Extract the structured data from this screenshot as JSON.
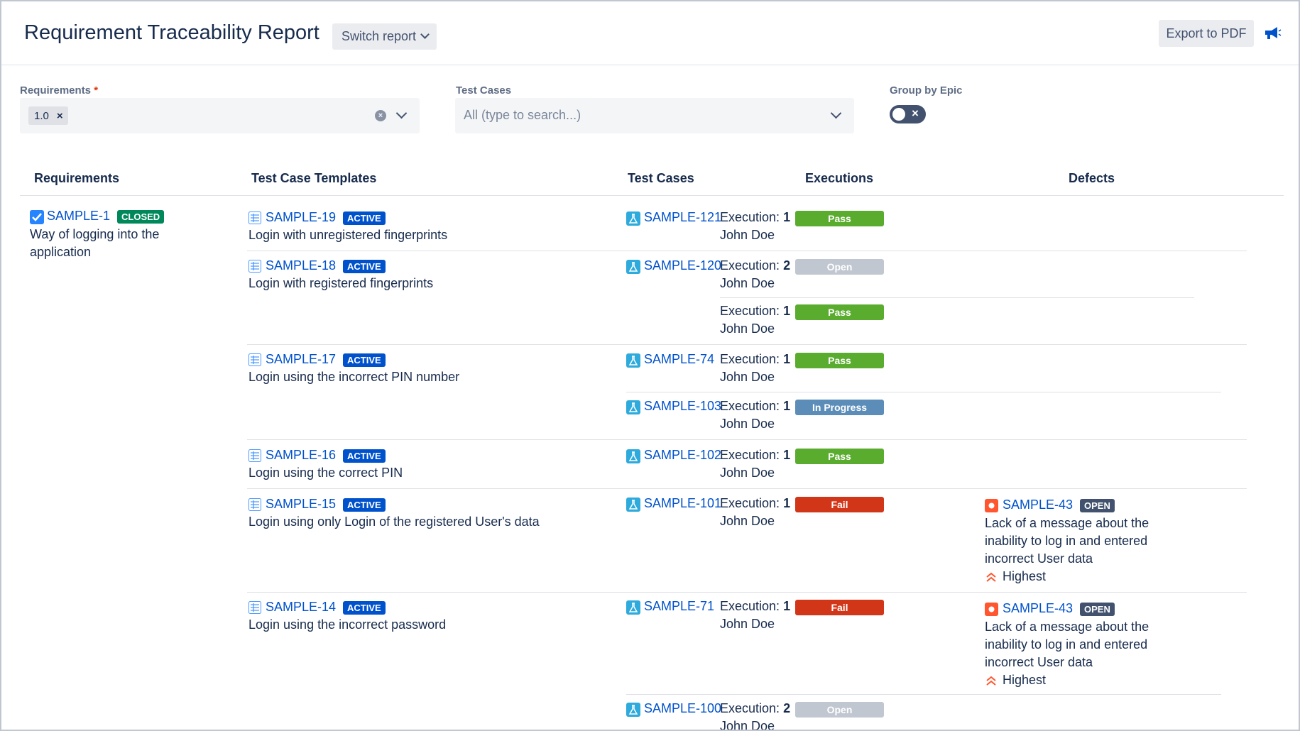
{
  "header": {
    "title": "Requirement Traceability Report",
    "switch_label": "Switch report",
    "export_label": "Export to PDF"
  },
  "filters": {
    "requirements_label": "Requirements",
    "requirements_required_mark": "*",
    "requirements_tag": "1.0",
    "test_cases_label": "Test Cases",
    "test_cases_placeholder": "All (type to search...)",
    "group_by_epic_label": "Group by Epic",
    "group_by_epic_on": false
  },
  "columns": {
    "requirements": "Requirements",
    "templates": "Test Case Templates",
    "test_cases": "Test Cases",
    "executions": "Executions",
    "defects": "Defects"
  },
  "requirement": {
    "key": "SAMPLE-1",
    "status": "CLOSED",
    "summary_line1": "Way of logging into the",
    "summary_line2": "application"
  },
  "execution_label": "Execution:",
  "templates": [
    {
      "key": "SAMPLE-19",
      "status": "ACTIVE",
      "summary": "Login with unregistered fingerprints"
    },
    {
      "key": "SAMPLE-18",
      "status": "ACTIVE",
      "summary": "Login with registered fingerprints"
    },
    {
      "key": "SAMPLE-17",
      "status": "ACTIVE",
      "summary": "Login using the incorrect PIN number"
    },
    {
      "key": "SAMPLE-16",
      "status": "ACTIVE",
      "summary": "Login using the correct PIN"
    },
    {
      "key": "SAMPLE-15",
      "status": "ACTIVE",
      "summary": "Login using only Login of the registered User's data"
    },
    {
      "key": "SAMPLE-14",
      "status": "ACTIVE",
      "summary": "Login using the incorrect password"
    }
  ],
  "test_cases": [
    {
      "key": "SAMPLE-121",
      "executions": [
        {
          "number": "1",
          "user": "John Doe",
          "status": "Pass"
        }
      ]
    },
    {
      "key": "SAMPLE-120",
      "executions": [
        {
          "number": "2",
          "user": "John Doe",
          "status": "Open"
        },
        {
          "number": "1",
          "user": "John Doe",
          "status": "Pass"
        }
      ]
    },
    {
      "key": "SAMPLE-74",
      "executions": [
        {
          "number": "1",
          "user": "John Doe",
          "status": "Pass"
        }
      ]
    },
    {
      "key": "SAMPLE-103",
      "executions": [
        {
          "number": "1",
          "user": "John Doe",
          "status": "In Progress"
        }
      ]
    },
    {
      "key": "SAMPLE-102",
      "executions": [
        {
          "number": "1",
          "user": "John Doe",
          "status": "Pass"
        }
      ]
    },
    {
      "key": "SAMPLE-101",
      "executions": [
        {
          "number": "1",
          "user": "John Doe",
          "status": "Fail"
        }
      ]
    },
    {
      "key": "SAMPLE-71",
      "executions": [
        {
          "number": "1",
          "user": "John Doe",
          "status": "Fail"
        }
      ]
    },
    {
      "key": "SAMPLE-100",
      "executions": [
        {
          "number": "2",
          "user": "John Doe",
          "status": "Open"
        }
      ]
    }
  ],
  "defects": [
    {
      "key": "SAMPLE-43",
      "status": "OPEN",
      "line1": "Lack of a message about the",
      "line2": "inability to log in and entered",
      "line3": "incorrect User data",
      "priority": "Highest"
    },
    {
      "key": "SAMPLE-43",
      "status": "OPEN",
      "line1": "Lack of a message about the",
      "line2": "inability to log in and entered",
      "line3": "incorrect User data",
      "priority": "Highest"
    }
  ],
  "colors": {
    "link": "#0052cc",
    "pass": "#5aac2e",
    "fail": "#d23618",
    "open": "#c1c7d0",
    "in_progress": "#5b8db8",
    "active_lozenge": "#0052cc",
    "closed_lozenge": "#00875a",
    "open_lozenge": "#42526e",
    "priority_highest": "#ff5630"
  }
}
